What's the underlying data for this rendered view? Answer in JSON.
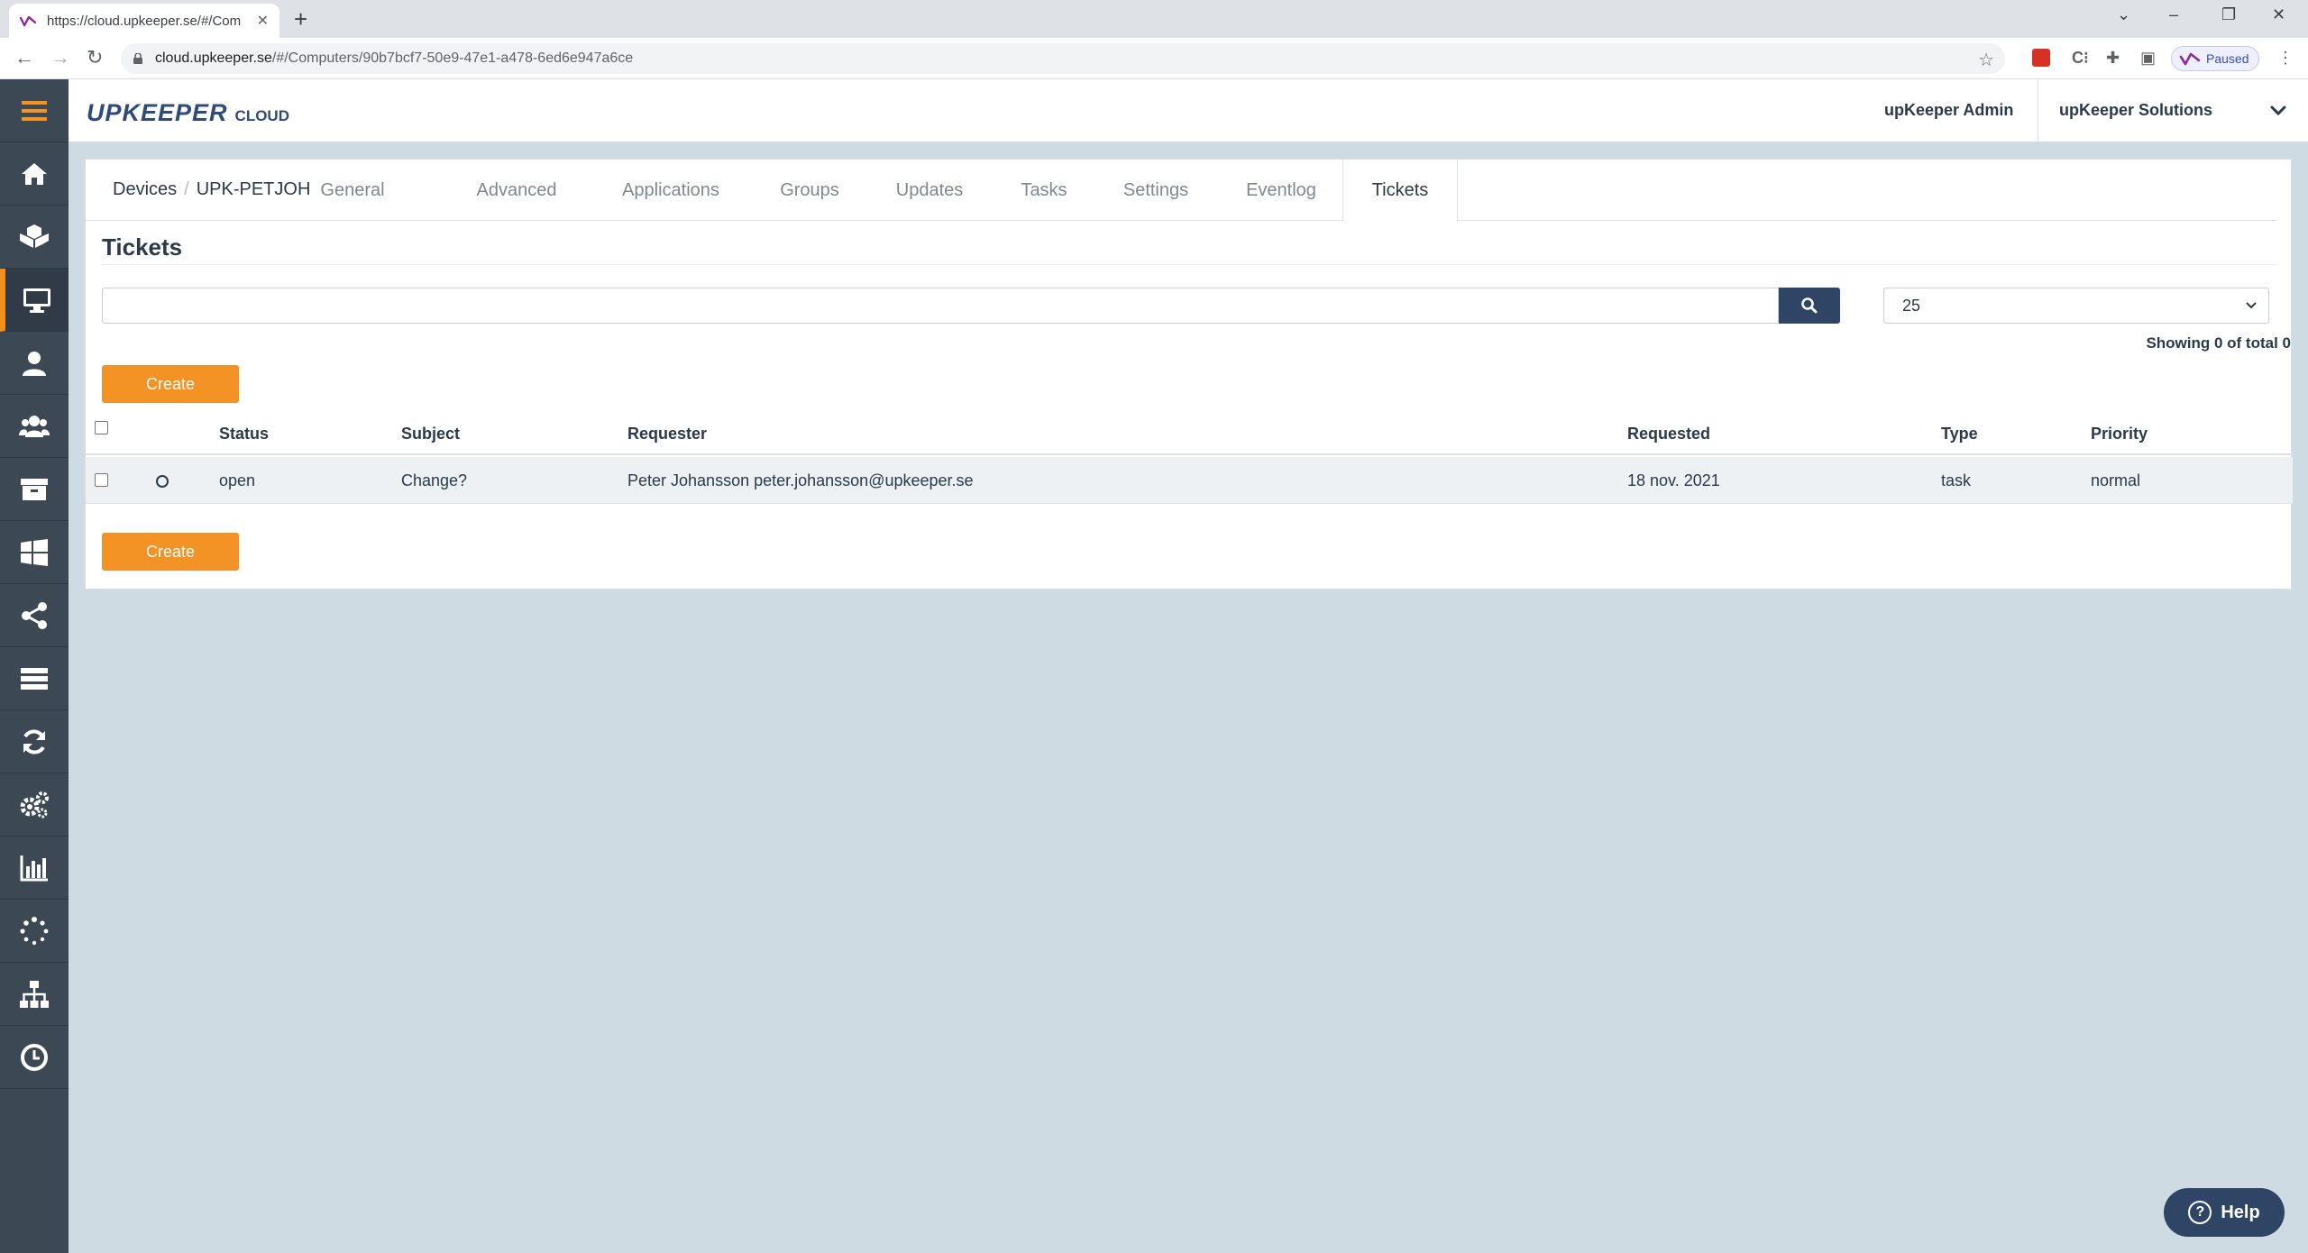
{
  "browser": {
    "tab_title": "https://cloud.upkeeper.se/#/Com",
    "url_host": "cloud.upkeeper.se",
    "url_path": "/#/Computers/90b7bcf7-50e9-47e1-a478-6ed6e947a6ce",
    "profile_status": "Paused"
  },
  "header": {
    "logo_main": "UPKEEPER",
    "logo_sub": "CLOUD",
    "user": "upKeeper Admin",
    "organization": "upKeeper Solutions"
  },
  "sidebar": {
    "items": [
      {
        "icon": "menu-icon"
      },
      {
        "icon": "home-icon"
      },
      {
        "icon": "packages-icon"
      },
      {
        "icon": "computer-icon",
        "active": true
      },
      {
        "icon": "user-icon"
      },
      {
        "icon": "users-group-icon"
      },
      {
        "icon": "archive-icon"
      },
      {
        "icon": "windows-icon"
      },
      {
        "icon": "share-icon"
      },
      {
        "icon": "server-icon"
      },
      {
        "icon": "sync-icon"
      },
      {
        "icon": "gears-icon"
      },
      {
        "icon": "bar-chart-icon"
      },
      {
        "icon": "spinner-icon"
      },
      {
        "icon": "sitemap-icon"
      },
      {
        "icon": "clock-icon"
      }
    ]
  },
  "breadcrumb": {
    "root": "Devices",
    "separator": "/",
    "current": "UPK-PETJOH"
  },
  "tabs": [
    "General",
    "Advanced",
    "Applications",
    "Groups",
    "Updates",
    "Tasks",
    "Settings",
    "Eventlog",
    "Tickets"
  ],
  "active_tab": "Tickets",
  "page": {
    "title": "Tickets",
    "search_placeholder": "",
    "page_size": "25",
    "showing": "Showing 0 of total 0",
    "create_label": "Create"
  },
  "table": {
    "columns": [
      "Status",
      "Subject",
      "Requester",
      "Requested",
      "Type",
      "Priority"
    ],
    "rows": [
      {
        "status": "open",
        "subject": "Change?",
        "requester": "Peter Johansson peter.johansson@upkeeper.se",
        "requested": "18 nov. 2021",
        "type": "task",
        "priority": "normal"
      }
    ]
  },
  "help_label": "Help",
  "colors": {
    "accent": "#f39325",
    "navy": "#2e4565",
    "sidebar": "#3d4855",
    "background": "#cfdbe3"
  }
}
